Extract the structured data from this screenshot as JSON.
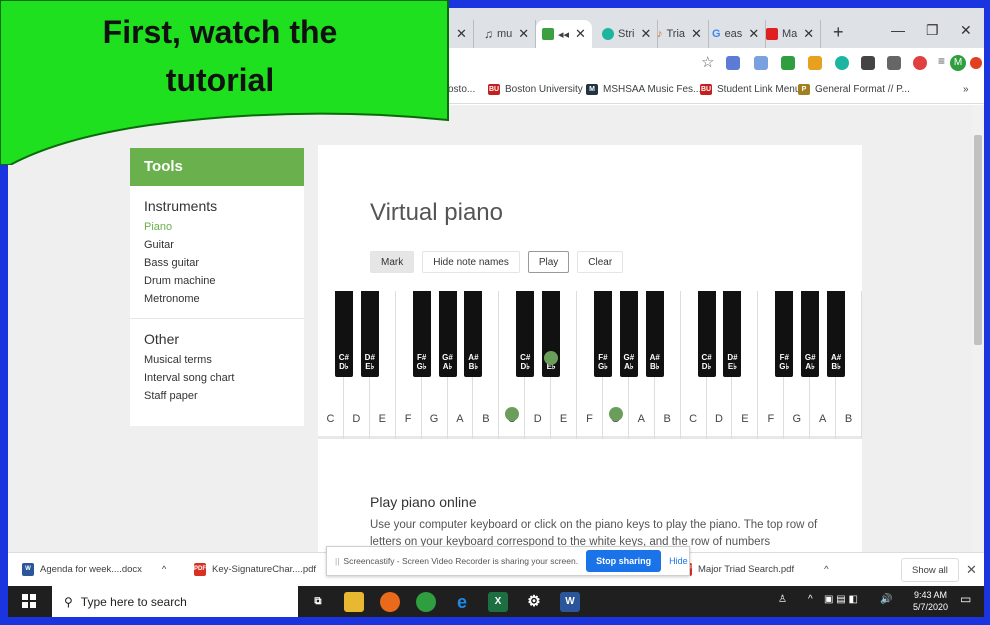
{
  "callout": {
    "line1": "First, watch the",
    "line2": "tutorial"
  },
  "tabs": [
    {
      "label": "mu"
    },
    {
      "label": ""
    },
    {
      "label": "Stri"
    },
    {
      "label": "Tria"
    },
    {
      "label": "eas"
    },
    {
      "label": "Ma"
    }
  ],
  "bookmarks": [
    {
      "label": "osto..."
    },
    {
      "label": "Boston University"
    },
    {
      "label": "MSHSAA Music Fes..."
    },
    {
      "label": "Student Link Menu"
    },
    {
      "label": "General Format // P..."
    }
  ],
  "sidebar": {
    "header": "Tools",
    "instruments_title": "Instruments",
    "instruments": [
      "Piano",
      "Guitar",
      "Bass guitar",
      "Drum machine",
      "Metronome"
    ],
    "other_title": "Other",
    "other": [
      "Musical terms",
      "Interval song chart",
      "Staff paper"
    ]
  },
  "main": {
    "title": "Virtual piano",
    "buttons": {
      "mark": "Mark",
      "hide": "Hide note names",
      "play": "Play",
      "clear": "Clear"
    },
    "white_keys": [
      "C",
      "D",
      "E",
      "F",
      "G",
      "A",
      "B",
      "C",
      "D",
      "E",
      "F",
      "G",
      "A",
      "B",
      "C",
      "D",
      "E",
      "F",
      "G",
      "A",
      "B"
    ],
    "black_keys": [
      {
        "top": "C#",
        "bottom": "D♭"
      },
      {
        "top": "D#",
        "bottom": "E♭"
      },
      {
        "top": "F#",
        "bottom": "G♭"
      },
      {
        "top": "G#",
        "bottom": "A♭"
      },
      {
        "top": "A#",
        "bottom": "B♭"
      },
      {
        "top": "C#",
        "bottom": "D♭"
      },
      {
        "top": "D#",
        "bottom": "E♭"
      },
      {
        "top": "F#",
        "bottom": "G♭"
      },
      {
        "top": "G#",
        "bottom": "A♭"
      },
      {
        "top": "A#",
        "bottom": "B♭"
      },
      {
        "top": "C#",
        "bottom": "D♭"
      },
      {
        "top": "D#",
        "bottom": "E♭"
      },
      {
        "top": "F#",
        "bottom": "G♭"
      },
      {
        "top": "G#",
        "bottom": "A♭"
      },
      {
        "top": "A#",
        "bottom": "B♭"
      }
    ],
    "marked_notes": [
      "C (2nd octave)",
      "G (2nd octave)",
      "E♭ (2nd octave)"
    ],
    "section_title": "Play piano online",
    "section_text": "Use your computer keyboard or click on the piano keys to play the piano. The top row of letters on your keyboard correspond to the white keys, and the row of numbers"
  },
  "screencastify": {
    "message": "Screencastify - Screen Video Recorder is sharing your screen.",
    "stop": "Stop sharing",
    "hide": "Hide"
  },
  "downloads": {
    "items": [
      "Agenda for week....docx",
      "Key-SignatureChar....pdf",
      "Major Triad Search.pdf"
    ],
    "show_all": "Show all"
  },
  "taskbar": {
    "search_placeholder": "Type here to search",
    "time": "9:43 AM",
    "date": "5/7/2020"
  },
  "colors": {
    "accent_green": "#6ab04c",
    "callout_green": "#1ee01e",
    "frame_blue": "#1a35e0"
  }
}
